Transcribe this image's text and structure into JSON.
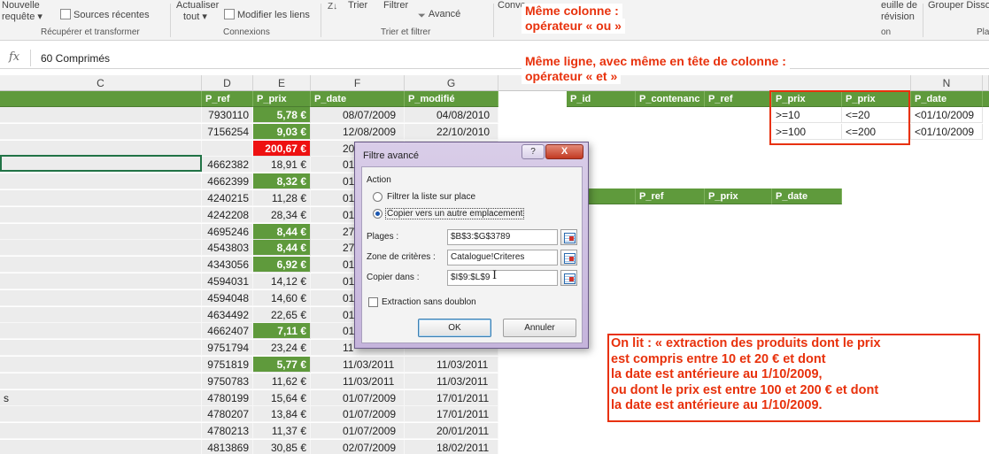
{
  "ribbon": {
    "nouvelle": "Nouvelle",
    "requete": "requête ▾",
    "sources_recentes": "Sources récentes",
    "actualiser": "Actualiser",
    "tout": "tout ▾",
    "modifier_liens": "Modifier les liens",
    "trier_icon_text": "Z↓",
    "trier": "Trier",
    "filtrer": "Filtrer",
    "avance": "Avancé",
    "conv": "Conve",
    "feuille_de": "euille de",
    "prevision": "révision",
    "grouper": "Grouper Dissoc",
    "on": "on",
    "pla": "Pla",
    "groups": {
      "recuperer": "Récupérer et transformer",
      "connexions": "Connexions",
      "trier_filtrer": "Trier et filtrer"
    }
  },
  "formula_bar": {
    "fx": "fx",
    "value": "60 Comprimés"
  },
  "columns": {
    "C": "C",
    "D": "D",
    "E": "E",
    "F": "F",
    "G": "G",
    "N": "N"
  },
  "headers": {
    "p_ref": "P_ref",
    "p_prix": "P_prix",
    "p_date": "P_date",
    "p_modifie": "P_modifié",
    "p_id": "P_id",
    "p_contenance": "P_contenanc",
    "p_ref2": "P_ref",
    "crit_prix1": "P_prix",
    "crit_prix2": "P_prix",
    "crit_date": "P_date",
    "out_ref": "P_ref",
    "out_prix": "P_prix",
    "out_date": "P_date"
  },
  "criteria_rows": [
    {
      "a": ">=10",
      "b": "<=20",
      "c": "<01/10/2009"
    },
    {
      "a": ">=100",
      "b": "<=200",
      "c": "<01/10/2009"
    }
  ],
  "rows": [
    {
      "c": "",
      "d": "7930110",
      "e": "5,78 €",
      "e_style": "hl",
      "f": "08/07/2009",
      "g": "04/08/2010"
    },
    {
      "c": "",
      "d": "7156254",
      "e": "9,03 €",
      "e_style": "hl",
      "f": "12/08/2009",
      "g": "22/10/2010"
    },
    {
      "c": "",
      "d": "",
      "e": "200,67 €",
      "e_style": "red",
      "f": "20",
      "g": ""
    },
    {
      "c": "",
      "d": "4662382",
      "e": "18,91 €",
      "e_style": "plain",
      "f": "01",
      "g": ""
    },
    {
      "c": "",
      "d": "4662399",
      "e": "8,32 €",
      "e_style": "hl",
      "f": "01",
      "g": ""
    },
    {
      "c": "",
      "d": "4240215",
      "e": "11,28 €",
      "e_style": "plain",
      "f": "01",
      "g": ""
    },
    {
      "c": "",
      "d": "4242208",
      "e": "28,34 €",
      "e_style": "plain",
      "f": "01",
      "g": ""
    },
    {
      "c": "",
      "d": "4695246",
      "e": "8,44 €",
      "e_style": "hl",
      "f": "27",
      "g": ""
    },
    {
      "c": "",
      "d": "4543803",
      "e": "8,44 €",
      "e_style": "hl",
      "f": "27",
      "g": ""
    },
    {
      "c": "",
      "d": "4343056",
      "e": "6,92 €",
      "e_style": "hl",
      "f": "01",
      "g": ""
    },
    {
      "c": "",
      "d": "4594031",
      "e": "14,12 €",
      "e_style": "plain",
      "f": "01",
      "g": ""
    },
    {
      "c": "",
      "d": "4594048",
      "e": "14,60 €",
      "e_style": "plain",
      "f": "01",
      "g": ""
    },
    {
      "c": "",
      "d": "4634492",
      "e": "22,65 €",
      "e_style": "plain",
      "f": "01",
      "g": ""
    },
    {
      "c": "",
      "d": "4662407",
      "e": "7,11 €",
      "e_style": "hl",
      "f": "01",
      "g": ""
    },
    {
      "c": "",
      "d": "9751794",
      "e": "23,24 €",
      "e_style": "plain",
      "f": "11",
      "g": ""
    },
    {
      "c": "",
      "d": "9751819",
      "e": "5,77 €",
      "e_style": "hl",
      "f": "11/03/2011",
      "g": "11/03/2011"
    },
    {
      "c": "",
      "d": "9750783",
      "e": "11,62 €",
      "e_style": "plain",
      "f": "11/03/2011",
      "g": "11/03/2011"
    },
    {
      "c": "s",
      "d": "4780199",
      "e": "15,64 €",
      "e_style": "plain",
      "f": "01/07/2009",
      "g": "17/01/2011"
    },
    {
      "c": "",
      "d": "4780207",
      "e": "13,84 €",
      "e_style": "plain",
      "f": "01/07/2009",
      "g": "17/01/2011"
    },
    {
      "c": "",
      "d": "4780213",
      "e": "11,37 €",
      "e_style": "plain",
      "f": "01/07/2009",
      "g": "20/01/2011"
    },
    {
      "c": "",
      "d": "4813869",
      "e": "30,85 €",
      "e_style": "plain",
      "f": "02/07/2009",
      "g": "18/02/2011"
    },
    {
      "c": "",
      "d": "4813875",
      "e": "16,64 €",
      "e_style": "plain",
      "f": "07/07/2009",
      "g": "18/02/2011"
    }
  ],
  "annotations": {
    "top_lines": [
      "Même colonne :",
      "opérateur « ou »",
      "",
      "Même ligne, avec même en tête de colonne :",
      "opérateur « et »"
    ],
    "box_lines": [
      "On lit : « extraction des produits dont le prix",
      "est compris entre 10 et 20 € et dont",
      "la date est antérieure au 1/10/2009,",
      "ou dont le prix est  entre 100 et 200 € et dont",
      "la date est antérieure au 1/10/2009."
    ]
  },
  "dialog": {
    "title": "Filtre avancé",
    "help": "?",
    "close": "X",
    "action_label": "Action",
    "radio_filter": "Filtrer la liste sur place",
    "radio_copy": "Copier vers un autre emplacement",
    "plages_label": "Plages :",
    "plages_value": "$B$3:$G$3789",
    "criteres_label": "Zone de critères :",
    "criteres_value": "Catalogue!Criteres",
    "copier_label": "Copier dans :",
    "copier_value": "$I$9:$L$9",
    "extraction_label": "Extraction sans doublon",
    "ok": "OK",
    "cancel": "Annuler"
  }
}
